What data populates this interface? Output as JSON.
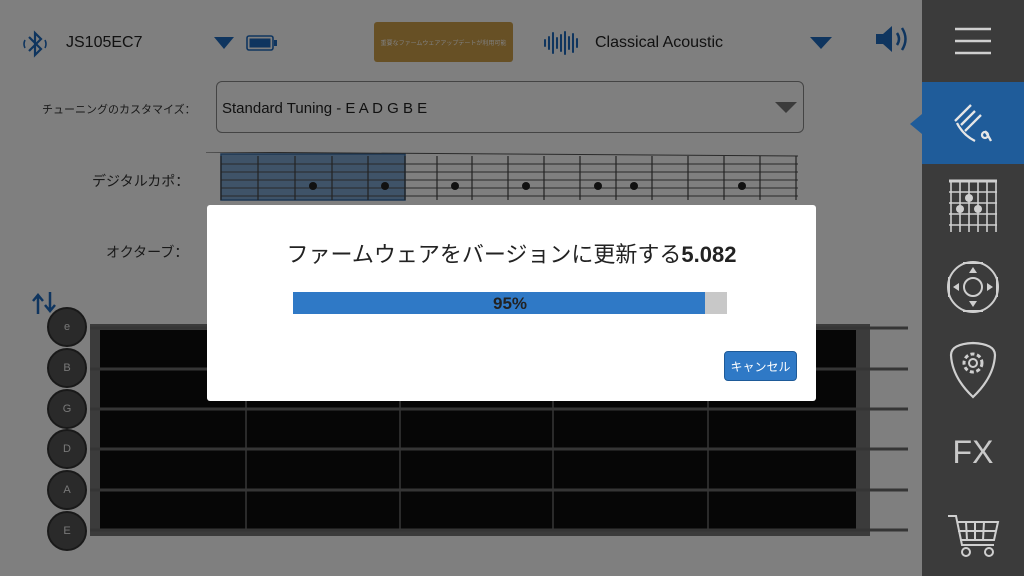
{
  "header": {
    "device_name": "JS105EC7",
    "update_badge": "重要なファームウェアアップデートが利用可能",
    "voice_name": "Classical Acoustic"
  },
  "tuning": {
    "label": "チューニングのカスタマイズ：",
    "value": "Standard Tuning - E A D G B E"
  },
  "capo": {
    "label": "デジタルカポ："
  },
  "octave": {
    "label": "オクターブ："
  },
  "strings": [
    "e",
    "B",
    "G",
    "D",
    "A",
    "E"
  ],
  "sidebar": {
    "fx_label": "FX"
  },
  "modal": {
    "title": "ファームウェアをバージョンに更新する",
    "version": "5.082",
    "progress_label": "95%",
    "progress_fraction": 0.95,
    "cancel_label": "キャンセル"
  },
  "colors": {
    "accent_blue": "#2f79c6",
    "sidebar_active": "#1f5c9a",
    "badge_gold": "#cfa04b",
    "sidebar_bg": "#3b3b3b"
  }
}
